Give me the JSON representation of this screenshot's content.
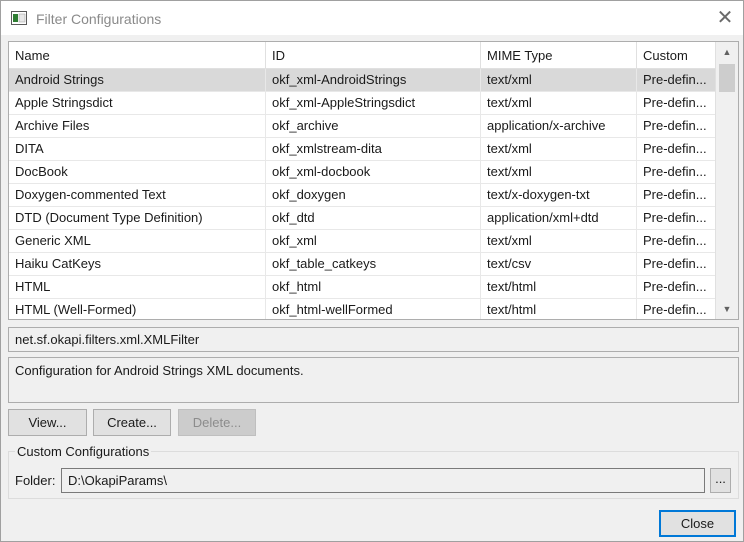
{
  "window": {
    "title": "Filter Configurations",
    "close_glyph": "✕"
  },
  "table": {
    "columns": [
      "Name",
      "ID",
      "MIME Type",
      "Custom"
    ],
    "rows": [
      {
        "name": "Android Strings",
        "id": "okf_xml-AndroidStrings",
        "mime": "text/xml",
        "custom": "Pre-defin..."
      },
      {
        "name": "Apple Stringsdict",
        "id": "okf_xml-AppleStringsdict",
        "mime": "text/xml",
        "custom": "Pre-defin..."
      },
      {
        "name": "Archive Files",
        "id": "okf_archive",
        "mime": "application/x-archive",
        "custom": "Pre-defin..."
      },
      {
        "name": "DITA",
        "id": "okf_xmlstream-dita",
        "mime": "text/xml",
        "custom": "Pre-defin..."
      },
      {
        "name": "DocBook",
        "id": "okf_xml-docbook",
        "mime": "text/xml",
        "custom": "Pre-defin..."
      },
      {
        "name": "Doxygen-commented Text",
        "id": "okf_doxygen",
        "mime": "text/x-doxygen-txt",
        "custom": "Pre-defin..."
      },
      {
        "name": "DTD (Document Type Definition)",
        "id": "okf_dtd",
        "mime": "application/xml+dtd",
        "custom": "Pre-defin..."
      },
      {
        "name": "Generic XML",
        "id": "okf_xml",
        "mime": "text/xml",
        "custom": "Pre-defin..."
      },
      {
        "name": "Haiku CatKeys",
        "id": "okf_table_catkeys",
        "mime": "text/csv",
        "custom": "Pre-defin..."
      },
      {
        "name": "HTML",
        "id": "okf_html",
        "mime": "text/html",
        "custom": "Pre-defin..."
      },
      {
        "name": "HTML (Well-Formed)",
        "id": "okf_html-wellFormed",
        "mime": "text/html",
        "custom": "Pre-defin..."
      }
    ],
    "selected_index": 0
  },
  "details": {
    "class_name": "net.sf.okapi.filters.xml.XMLFilter",
    "description": "Configuration for Android Strings XML documents."
  },
  "buttons": {
    "view": "View...",
    "create": "Create...",
    "delete": "Delete...",
    "close": "Close"
  },
  "custom_configurations": {
    "group_label": "Custom Configurations",
    "folder_label": "Folder:",
    "folder_value": "D:\\OkapiParams\\",
    "browse_label": "..."
  },
  "colors": {
    "selected_row": "#d9d9d9",
    "accent": "#0078d7"
  }
}
